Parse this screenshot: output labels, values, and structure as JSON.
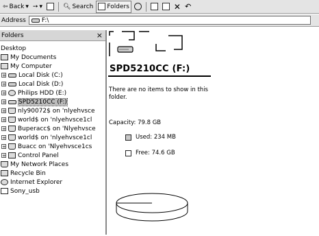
{
  "toolbar": {
    "back_label": "Back",
    "search_label": "Search",
    "folders_label": "Folders"
  },
  "address": {
    "label": "Address",
    "value": "F:\\"
  },
  "folders_pane": {
    "title": "Folders",
    "close_symbol": "×",
    "items": [
      {
        "label": "Desktop"
      },
      {
        "label": "My Documents"
      },
      {
        "label": "My Computer"
      },
      {
        "label": "Local Disk (C:)"
      },
      {
        "label": "Local Disk (D:)"
      },
      {
        "label": "Philips HDD (E:)"
      },
      {
        "label": "SPD5210CC (F:)"
      },
      {
        "label": "nly90072$ on 'nlyehvsce"
      },
      {
        "label": "world$ on 'nlyehvsce1cl"
      },
      {
        "label": "Buperacc$ on 'Nlyehvsce"
      },
      {
        "label": "world$ on 'nlyehvsce1cl"
      },
      {
        "label": "Buacc on 'Nlyehvsce1cs"
      },
      {
        "label": "Control Panel"
      },
      {
        "label": "My Network Places"
      },
      {
        "label": "Recycle Bin"
      },
      {
        "label": "Internet Explorer"
      },
      {
        "label": "Sony_usb"
      }
    ]
  },
  "drive": {
    "title": "SPD5210CC (F:)",
    "empty_message": "There are no items to show in this folder.",
    "capacity_text": "Capacity: 79.8  GB",
    "used_text": "Used: 234 MB",
    "free_text": "Free: 74.6 GB",
    "used_fraction": 0.003,
    "used_color": "#c8c8c8",
    "free_color": "#ffffff"
  }
}
